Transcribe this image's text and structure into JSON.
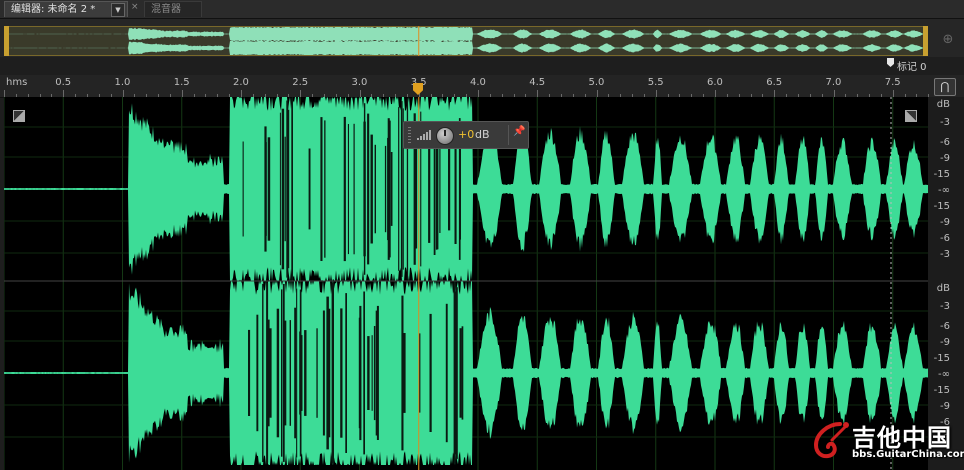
{
  "tabs": {
    "editor_label": "编辑器: 未命名 2 *",
    "mixer_label": "混音器",
    "dropdown_glyph": "▼",
    "close_glyph": "×"
  },
  "ruler": {
    "unit_label": "hms",
    "labels": [
      "0.5",
      "1.0",
      "1.5",
      "2.0",
      "2.5",
      "3.0",
      "3.5",
      "4.0",
      "4.5",
      "5.0",
      "5.5",
      "6.0",
      "6.5",
      "7.0",
      "7.5"
    ]
  },
  "marker": {
    "label": "标记 0"
  },
  "db_scale": {
    "unit": "dB",
    "labels": [
      "-3",
      "-6",
      "-9",
      "-15",
      "-∞",
      "-15",
      "-9",
      "-6",
      "-3"
    ]
  },
  "hud": {
    "value": "+0",
    "unit": "dB"
  },
  "playhead": {
    "time_seconds": 3.5
  },
  "colors": {
    "waveform": "#3ddc97",
    "playhead": "#e08a1e",
    "background": "#000000"
  },
  "icons": {
    "zoom": "zoom-icon",
    "snap": "magnet-icon",
    "pin": "pin-icon"
  },
  "watermark": {
    "title": "吉他中国",
    "url": "bbs.GuitarChina.com"
  }
}
